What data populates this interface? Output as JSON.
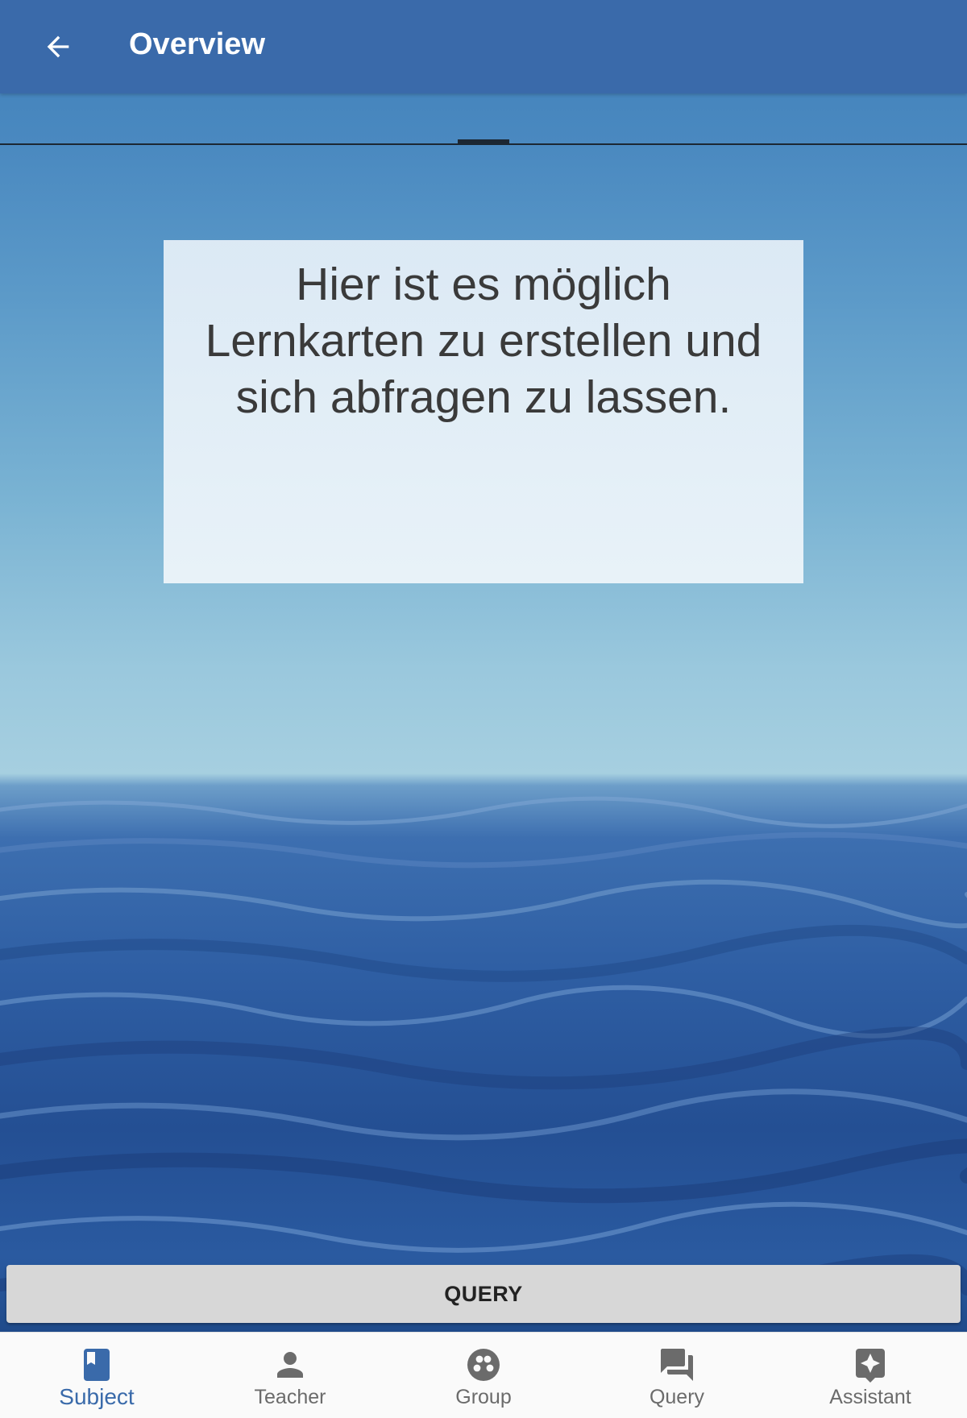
{
  "appbar": {
    "title": "Overview",
    "back_icon": "arrow-back-icon",
    "color": "#3a6aaa"
  },
  "card": {
    "lines": [
      "Hier ist es möglich",
      "Lernkarten zu erstellen und",
      "sich abfragen zu lassen."
    ]
  },
  "query_button": {
    "label": "QUERY"
  },
  "bottom_nav": {
    "active_color": "#3a6aaa",
    "inactive_color": "#6b6b6b",
    "items": [
      {
        "label": "Subject",
        "icon": "book-icon",
        "active": true
      },
      {
        "label": "Teacher",
        "icon": "person-icon",
        "active": false
      },
      {
        "label": "Group",
        "icon": "group-icon",
        "active": false
      },
      {
        "label": "Query",
        "icon": "chat-bubbles-icon",
        "active": false
      },
      {
        "label": "Assistant",
        "icon": "assistant-icon",
        "active": false
      }
    ]
  }
}
